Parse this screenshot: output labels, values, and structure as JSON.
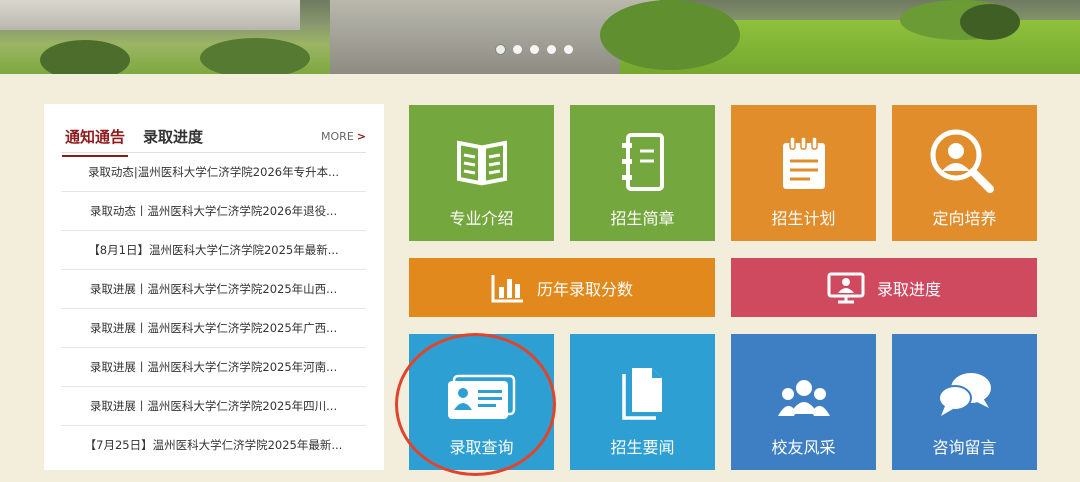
{
  "carousel": {
    "dots": 5,
    "active_index": 0
  },
  "news": {
    "tabs": [
      {
        "label": "通知通告",
        "active": true
      },
      {
        "label": "录取进度",
        "active": false
      }
    ],
    "more_label": "MORE",
    "items": [
      "录取动态|温州医科大学仁济学院2026年专升本...",
      "录取动态丨温州医科大学仁济学院2026年退役...",
      "【8月1日】温州医科大学仁济学院2025年最新...",
      "录取进展丨温州医科大学仁济学院2025年山西...",
      "录取进展丨温州医科大学仁济学院2025年广西...",
      "录取进展丨温州医科大学仁济学院2025年河南...",
      "录取进展丨温州医科大学仁济学院2025年四川...",
      "【7月25日】温州医科大学仁济学院2025年最新..."
    ]
  },
  "tiles": {
    "major": {
      "label": "专业介绍",
      "icon": "open-book-icon"
    },
    "brochure": {
      "label": "招生简章",
      "icon": "notebook-icon"
    },
    "plan": {
      "label": "招生计划",
      "icon": "notepad-icon"
    },
    "directed": {
      "label": "定向培养",
      "icon": "person-search-icon"
    },
    "scores": {
      "label": "历年录取分数",
      "icon": "bar-chart-icon"
    },
    "progress": {
      "label": "录取进度",
      "icon": "presentation-icon"
    },
    "query": {
      "label": "录取查询",
      "icon": "id-card-icon"
    },
    "news": {
      "label": "招生要闻",
      "icon": "document-icon"
    },
    "alumni": {
      "label": "校友风采",
      "icon": "group-icon"
    },
    "consult": {
      "label": "咨询留言",
      "icon": "chat-bubbles-icon"
    }
  },
  "colors": {
    "green": "#74a83e",
    "orange": "#e28d2c",
    "red": "#d04a5f",
    "blue": "#2e9fd2",
    "blue_dark": "#3e7fc4",
    "accent": "#8e1b1b",
    "highlight_circle": "#e0442c"
  }
}
